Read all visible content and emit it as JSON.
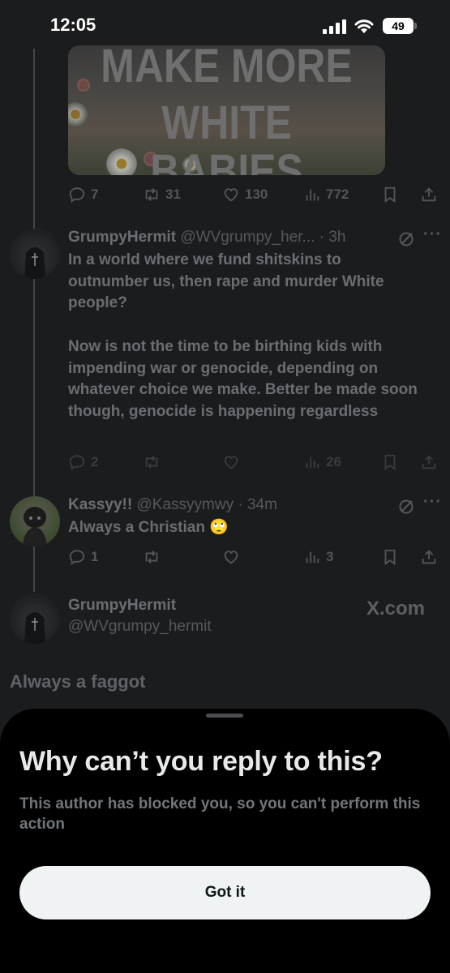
{
  "status_bar": {
    "time": "12:05",
    "battery": "49"
  },
  "media": {
    "line1": "MAKE MORE",
    "line2": "WHITE BABIES"
  },
  "tweet0_actions": {
    "replies": "7",
    "reposts": "31",
    "likes": "130",
    "views": "772"
  },
  "tweet1": {
    "name": "GrumpyHermit",
    "handle": "@WVgrumpy_her...",
    "time": "· 3h",
    "paragraph1": "In a world where we fund shitskins to outnumber us, then rape and murder White people?",
    "paragraph2": "Now is not the time to be birthing kids with impending war or genocide, depending on whatever choice we make. Better be made soon though, genocide is happening regardless",
    "replies": "2",
    "views": "26"
  },
  "tweet2": {
    "name": "Kassyy!!",
    "handle": "@Kassyymwy",
    "time": "· 34m",
    "text": "Always a Christian 🙄",
    "replies": "1",
    "views": "3"
  },
  "quoted": {
    "name": "GrumpyHermit",
    "handle": "@WVgrumpy_hermit",
    "site": "X.com",
    "text": "Always a faggot"
  },
  "sheet": {
    "title": "Why can’t you reply to this?",
    "message": "This author has blocked you, so you can't perform this action",
    "button": "Got it"
  },
  "colors": {
    "background": "#1b1c1e",
    "sheet": "#000000",
    "button": "#eff3f4",
    "dim_text": "#6a6d72"
  },
  "icons": [
    "signal-icon",
    "wifi-icon",
    "battery-icon",
    "reply-icon",
    "repost-icon",
    "like-icon",
    "views-icon",
    "bookmark-icon",
    "share-icon",
    "grok-icon",
    "more-icon"
  ]
}
